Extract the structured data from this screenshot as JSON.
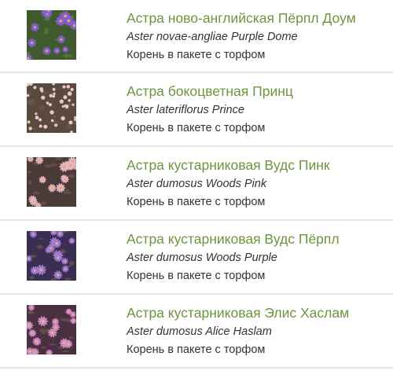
{
  "products": [
    {
      "title": "Астра ново-английская Пёрпл Доум",
      "latin": "Aster novae-angliae Purple Dome",
      "packaging": "Корень в пакете с торфом",
      "photo": "purple-aster-photo",
      "colors": {
        "bg": "#3f5a2c",
        "petal": "#8a5cd6",
        "center": "#e0c040"
      }
    },
    {
      "title": "Астра бокоцветная Принц",
      "latin": "Aster lateriflorus Prince",
      "packaging": "Корень в пакете с торфом",
      "photo": "pink-white-aster-photo",
      "colors": {
        "bg": "#5a4a3e",
        "petal": "#e8c8cc",
        "center": "#c88a9a"
      }
    },
    {
      "title": "Астра кустарниковая Вудс Пинк",
      "latin": "Aster dumosus Woods Pink",
      "packaging": "Корень в пакете с торфом",
      "photo": "pink-aster-photo",
      "colors": {
        "bg": "#4a3a38",
        "petal": "#e6b4c4",
        "center": "#d8b040"
      }
    },
    {
      "title": "Астра кустарниковая Вудс Пёрпл",
      "latin": "Aster dumosus Woods Purple",
      "packaging": "Корень в пакете с торфом",
      "photo": "violet-aster-photo",
      "colors": {
        "bg": "#3a2e52",
        "petal": "#a27ad8",
        "center": "#e2c040"
      }
    },
    {
      "title": "Астра кустарниковая Элис Хаслам",
      "latin": "Aster dumosus Alice Haslam",
      "packaging": "Корень в пакете с торфом",
      "photo": "magenta-aster-photo",
      "colors": {
        "bg": "#4a3040",
        "petal": "#d28ac8",
        "center": "#e8c448"
      }
    }
  ]
}
